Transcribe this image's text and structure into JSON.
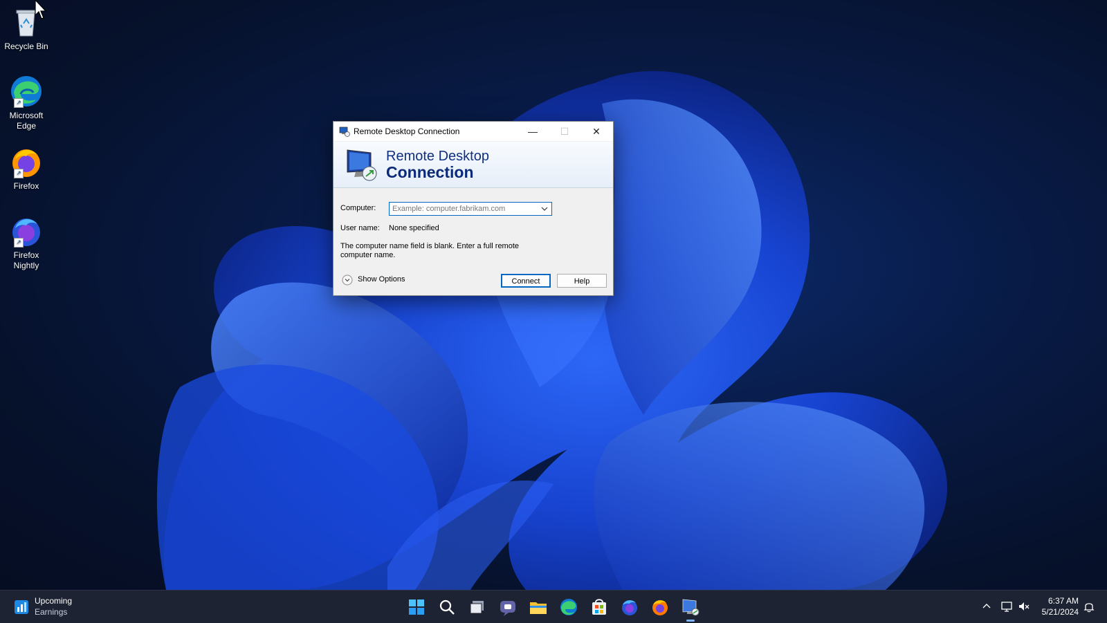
{
  "desktop": {
    "icons": [
      {
        "label": "Recycle Bin"
      },
      {
        "label": "Microsoft Edge"
      },
      {
        "label": "Firefox"
      },
      {
        "label": "Firefox Nightly"
      }
    ]
  },
  "dialog": {
    "title": "Remote Desktop Connection",
    "banner_line1": "Remote Desktop",
    "banner_line2": "Connection",
    "computer_label": "Computer:",
    "computer_placeholder": "Example: computer.fabrikam.com",
    "computer_value": "",
    "username_label": "User name:",
    "username_value": "None specified",
    "message": "The computer name field is blank. Enter a full remote computer name.",
    "show_options_label": "Show Options",
    "connect_label": "Connect",
    "help_label": "Help"
  },
  "taskbar": {
    "widget_line1": "Upcoming",
    "widget_line2": "Earnings",
    "apps": [
      "start-icon",
      "search-icon",
      "task-view-icon",
      "teams-chat-icon",
      "file-explorer-icon",
      "edge-icon",
      "store-icon",
      "firefox-nightly-icon",
      "firefox-icon",
      "remote-desktop-icon"
    ],
    "time": "6:37 AM",
    "date": "5/21/2024"
  },
  "colors": {
    "accent": "#0067c0",
    "taskbar": "#1d2333",
    "banner_text": "#0b2a78"
  }
}
